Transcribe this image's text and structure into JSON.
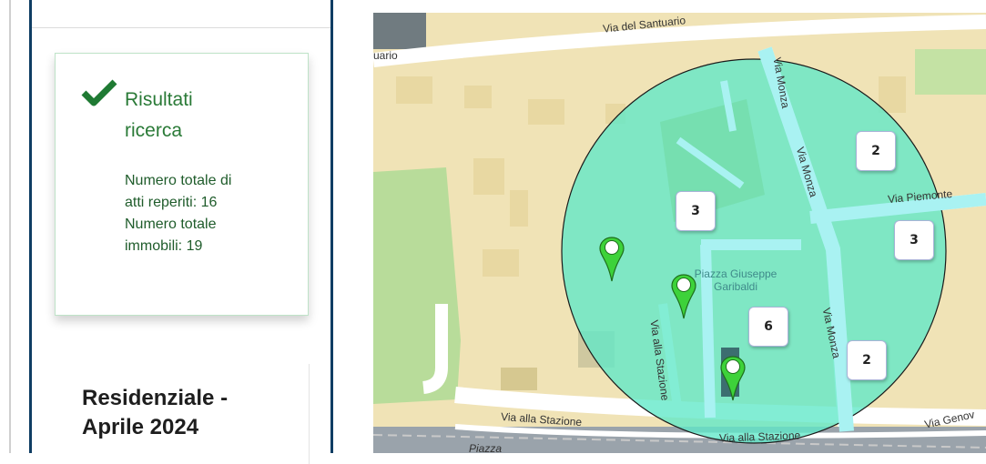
{
  "sidebar": {
    "results": {
      "title_line1": "Risultati",
      "title_line2": "ricerca",
      "total_acts_line1": "Numero totale di",
      "total_acts_line2": "atti reperiti: 16",
      "total_properties_line1": "Numero totale",
      "total_properties_line2": "immobili: 19",
      "accent_color": "#1f7a33"
    },
    "residential": {
      "title_line1": "Residenziale -",
      "title_line2": "Aprile 2024"
    }
  },
  "map": {
    "streets": {
      "santuario": "Via del Santuario",
      "santuario_cut": "uario",
      "monza_top": "Via Monza",
      "monza_mid": "Via Monza",
      "monza_low": "Via Monza",
      "piemonte": "Via Piemonte",
      "stazione_vertical": "Via alla Stazione",
      "stazione_bottom_left": "Via alla Stazione",
      "stazione_bottom_right": "Via alla Stazione",
      "genova_cut": "Via Genov",
      "piazza_cut": "Piazza"
    },
    "square_label_line1": "Piazza Giuseppe",
    "square_label_line2": "Garibaldi",
    "clusters": [
      "2",
      "3",
      "3",
      "6",
      "2"
    ],
    "marker_icon": "map-pin-icon",
    "search_radius_color": "#5fe8c8"
  }
}
